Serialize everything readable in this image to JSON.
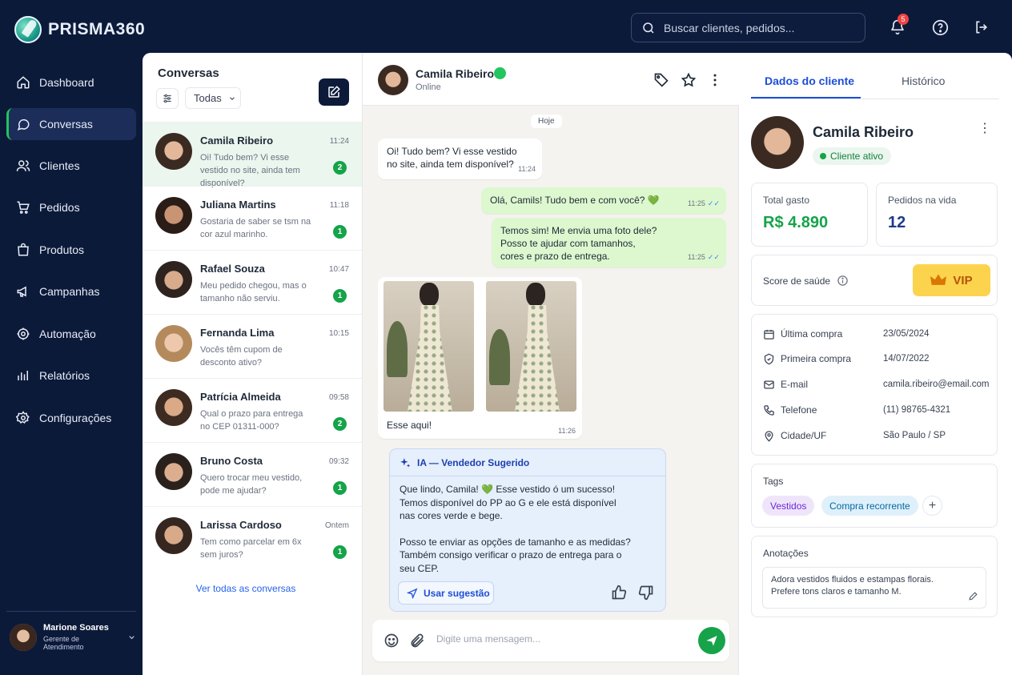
{
  "app": {
    "name": "PRISMA360"
  },
  "search": {
    "placeholder": "Buscar clientes, pedidos..."
  },
  "topbar": {
    "notifications_count": "5"
  },
  "nav": {
    "items": [
      {
        "label": "Dashboard",
        "icon": "home-icon"
      },
      {
        "label": "Conversas",
        "icon": "chat-icon",
        "active": true
      },
      {
        "label": "Clientes",
        "icon": "users-icon"
      },
      {
        "label": "Pedidos",
        "icon": "cart-icon"
      },
      {
        "label": "Produtos",
        "icon": "bag-icon"
      },
      {
        "label": "Campanhas",
        "icon": "megaphone-icon"
      },
      {
        "label": "Automação",
        "icon": "automation-icon"
      },
      {
        "label": "Relatórios",
        "icon": "chart-icon"
      },
      {
        "label": "Configurações",
        "icon": "gear-icon"
      }
    ]
  },
  "user": {
    "name": "Marione Soares",
    "role": "Gerente de Atendimento"
  },
  "conversations": {
    "title": "Conversas",
    "filter_value": "Todas",
    "see_all": "Ver todas as conversas",
    "items": [
      {
        "name": "Camila Ribeiro",
        "time": "11:24",
        "message": "Oi! Tudo bem? Vi esse vestido no site, ainda tem disponível?",
        "unread": "2"
      },
      {
        "name": "Juliana Martins",
        "time": "11:18",
        "message": "Gostaria de saber se tsm na cor azul marinho.",
        "unread": "1"
      },
      {
        "name": "Rafael Souza",
        "time": "10:47",
        "message": "Meu pedido chegou, mas o tamanho não serviu.",
        "unread": "1"
      },
      {
        "name": "Fernanda Lima",
        "time": "10:15",
        "message": "Vocês têm cupom de desconto ativo?",
        "unread": ""
      },
      {
        "name": "Patrícia Almeida",
        "time": "09:58",
        "message": "Qual o prazo para entrega no CEP 01311-000?",
        "unread": "2"
      },
      {
        "name": "Bruno Costa",
        "time": "09:32",
        "message": "Quero trocar meu vestido, pode me ajudar?",
        "unread": "1"
      },
      {
        "name": "Larissa Cardoso",
        "time": "Ontem",
        "message": "Tem como parcelar em 6x sem juros?",
        "unread": "1"
      }
    ]
  },
  "chat": {
    "contact_name": "Camila Ribeiro",
    "contact_status": "Online",
    "day_label": "Hoje",
    "messages": [
      {
        "direction": "in",
        "text_1": "Oi! Tudo bem? Vi esse vestido",
        "text_2": "no site, ainda tem disponível?",
        "time": "11:24"
      },
      {
        "direction": "out",
        "text_1": "Olá, Camils! Tudo bem e com você? 💚",
        "time": "11:25"
      },
      {
        "direction": "out",
        "text_1": "Temos sim! Me envia uma foto dele?",
        "text_2": "Posso te ajudar com tamanhos,",
        "text_3": "cores e prazo de entrega.",
        "time": "11:25"
      }
    ],
    "image_message": {
      "caption": "Esse aqui!",
      "time": "11:26"
    },
    "ai_suggestion": {
      "title": "IA — Vendedor Sugerido",
      "line_1": "Que lindo, Camila! 💚 Esse vestido ó um sucesso!",
      "line_2": "Temos disponível do PP ao G e ele está disponível",
      "line_3": "nas cores verde e bege.",
      "line_4": "Posso te enviar as opções de tamanho e as medidas?",
      "line_5": "Também consigo verificar o prazo de entrega para o",
      "line_6": "seu CEP.",
      "use_button": "Usar sugestão"
    },
    "composer_placeholder": "Digite uma mensagem..."
  },
  "details": {
    "tabs": [
      "Dados do cliente",
      "Histórico"
    ],
    "name": "Camila Ribeiro",
    "status": "Cliente ativo",
    "total_spent_label": "Total gasto",
    "total_spent_value": "R$ 4.890",
    "orders_label": "Pedidos na vida",
    "orders_value": "12",
    "health_label": "Score de saúde",
    "health_badge": "VIP",
    "info": [
      {
        "label": "Última compra",
        "value": "23/05/2024",
        "icon": "calendar-icon"
      },
      {
        "label": "Primeira compra",
        "value": "14/07/2022",
        "icon": "shield-icon"
      },
      {
        "label": "E-mail",
        "value": "camila.ribeiro@email.com",
        "icon": "mail-icon"
      },
      {
        "label": "Telefone",
        "value": "(11) 98765-4321",
        "icon": "phone-icon"
      },
      {
        "label": "Cidade/UF",
        "value": "São Paulo / SP",
        "icon": "pin-icon"
      }
    ],
    "tags_label": "Tags",
    "tags": [
      "Vestidos",
      "Compra recorrente"
    ],
    "notes_label": "Anotações",
    "notes_line_1": "Adora vestidos fluidos e estampas florais.",
    "notes_line_2": "Prefere tons claros e tamanho M."
  },
  "colors": {
    "brand_dark": "#0c1a3a",
    "accent_green": "#16a34a",
    "accent_blue": "#1d4ed8",
    "vip_yellow": "#fcd34d"
  }
}
